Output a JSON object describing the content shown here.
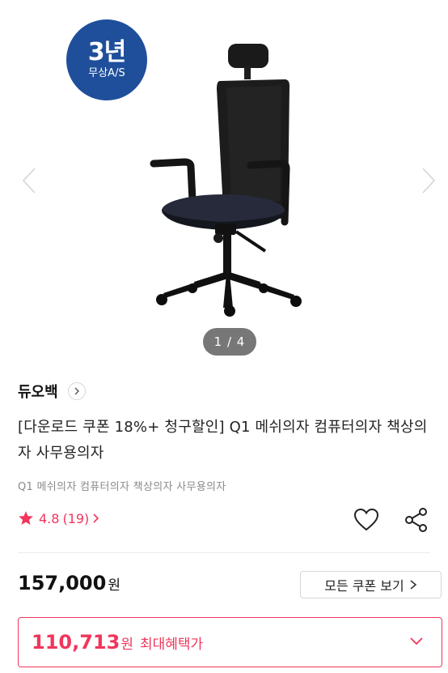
{
  "colors": {
    "accent": "#f0365c",
    "badge_bg": "#1f4f9b",
    "text_primary": "#111111",
    "text_muted": "#8a8a8a"
  },
  "gallery": {
    "badge": {
      "title": "3년",
      "subtitle": "무상A/S"
    },
    "counter": "1 / 4"
  },
  "brand": {
    "name": "듀오백"
  },
  "product": {
    "title": "[다운로드 쿠폰 18%+ 청구할인] Q1 메쉬의자 컴퓨터의자 책상의자 사무용의자",
    "subtitle": "Q1 메쉬의자 컴퓨터의자 책상의자 사무용의자"
  },
  "rating": {
    "score": "4.8",
    "count": "(19)"
  },
  "icons": {
    "prev": "chevron-left-icon",
    "next": "chevron-right-icon",
    "wishlist": "heart-icon",
    "share": "share-icon",
    "star": "star-icon"
  },
  "price": {
    "value": "157,000",
    "unit": "원"
  },
  "coupon_button": {
    "label": "모든 쿠폰 보기"
  },
  "benefit": {
    "value": "110,713",
    "unit": "원",
    "label": "최대혜택가"
  }
}
